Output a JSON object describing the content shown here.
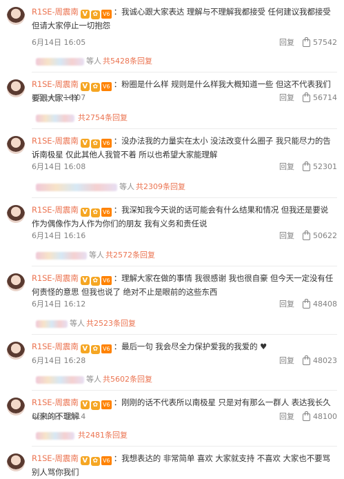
{
  "comments": [
    {
      "author": "R1SE-周震南",
      "badge_v": "V",
      "badge_m": "✿",
      "badge_w": "V6",
      "text": "：我诚心跟大家表达 理解与不理解我都接受 任何建议我都接受 但请大家停止一切抱怨",
      "time": "6月14日 16:05",
      "reply_label": "回复",
      "likes": "57542",
      "replies_prefix": "等人",
      "replies_count": "共5428条回复"
    },
    {
      "author": "R1SE-周震南",
      "badge_v": "V",
      "badge_m": "✿",
      "badge_w": "V6",
      "text": "：粉圈是什么样 规则是什么样我大概知道一些 但这不代表我们要跟大家一样",
      "time": "6月14日 16:07",
      "reply_label": "回复",
      "likes": "56714",
      "replies_prefix": "",
      "replies_count": "共2754条回复"
    },
    {
      "author": "R1SE-周震南",
      "badge_v": "V",
      "badge_m": "✿",
      "badge_w": "V6",
      "text": "：没办法我的力量实在太小 没法改变什么圈子 我只能尽力的告诉南极星 仅此其他人我管不着 所以也希望大家能理解",
      "time": "6月14日 16:08",
      "reply_label": "回复",
      "likes": "52301",
      "replies_prefix": "等人",
      "replies_count": "共2309条回复"
    },
    {
      "author": "R1SE-周震南",
      "badge_v": "V",
      "badge_m": "✿",
      "badge_w": "V6",
      "text": "：我深知我今天说的话可能会有什么结果和情况 但我还是要说 作为偶像作为人作为你们的朋友 我有义务和责任说",
      "time": "6月14日 16:16",
      "reply_label": "回复",
      "likes": "50622",
      "replies_prefix": "等人",
      "replies_count": "共2572条回复"
    },
    {
      "author": "R1SE-周震南",
      "badge_v": "V",
      "badge_m": "✿",
      "badge_w": "V6",
      "text": "：理解大家在做的事情 我很感谢 我也很自豪 但今天一定没有任何责怪的意思 但我也说了 绝对不止是眼前的这些东西",
      "time": "6月14日 16:12",
      "reply_label": "回复",
      "likes": "48408",
      "replies_prefix": "等人",
      "replies_count": "共2523条回复"
    },
    {
      "author": "R1SE-周震南",
      "badge_v": "V",
      "badge_m": "✿",
      "badge_w": "V6",
      "text": "：最后一句 我会尽全力保护爱我的我爱的 ♥",
      "time": "6月14日 16:28",
      "reply_label": "回复",
      "likes": "48023",
      "replies_prefix": "等人",
      "replies_count": "共5602条回复"
    },
    {
      "author": "R1SE-周震南",
      "badge_v": "V",
      "badge_m": "✿",
      "badge_w": "V6",
      "text": "：刚刚的话不代表所以南极星 只是对有那么一群人 表达我长久以来的不理解",
      "time": "6月14日 16:14",
      "reply_label": "回复",
      "likes": "48100",
      "replies_prefix": "",
      "replies_count": "共2481条回复"
    },
    {
      "author": "R1SE-周震南",
      "badge_v": "V",
      "badge_m": "✿",
      "badge_w": "V6",
      "text": "：我想表达的 非常简单 喜欢 大家就支持 不喜欢 大家也不要骂 别人骂你我们",
      "time": "",
      "reply_label": "",
      "likes": "",
      "replies_prefix": "",
      "replies_count": ""
    }
  ]
}
